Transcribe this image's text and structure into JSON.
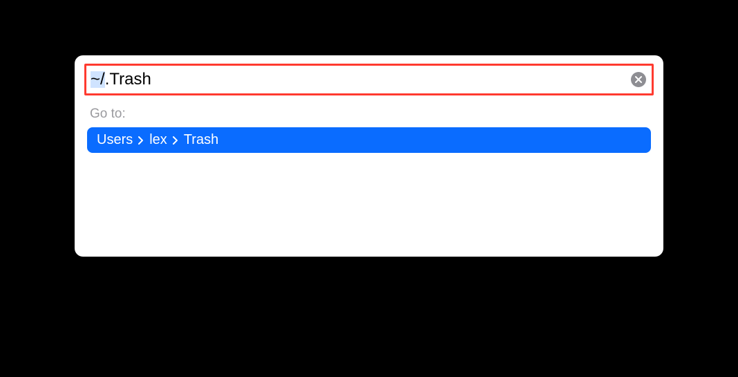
{
  "input": {
    "value": "~/.Trash",
    "highlighted_part": "~/",
    "remaining_part": ".Trash"
  },
  "goto_label": "Go to:",
  "breadcrumb": {
    "segments": [
      "Users",
      "lex",
      "Trash"
    ]
  },
  "colors": {
    "highlight_border": "#ff3a2f",
    "selection_bg": "#0a6cff",
    "text_highlight": "#cfe3ff"
  }
}
